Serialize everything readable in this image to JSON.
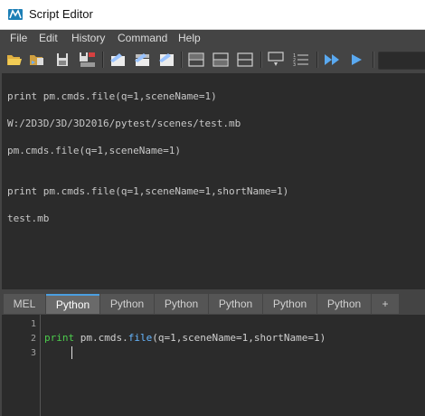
{
  "window": {
    "title": "Script Editor"
  },
  "menu": [
    "File",
    "Edit",
    "History",
    "Command",
    "Help"
  ],
  "toolbar": {
    "icons": [
      "open-script-icon",
      "source-script-icon",
      "save-script-icon",
      "save-to-shelf-icon",
      "clear-history-icon",
      "clear-input-icon",
      "clear-all-icon",
      "show-history-only-icon",
      "show-input-only-icon",
      "show-both-icon",
      "echo-all-commands-icon",
      "line-numbers-icon",
      "execute-all-icon",
      "execute-icon"
    ]
  },
  "output": {
    "lines": [
      "print pm.cmds.file(q=1,sceneName=1)",
      "W:/2D3D/3D/3D2016/pytest/scenes/test.mb",
      "pm.cmds.file(q=1,sceneName=1)",
      "print pm.cmds.file(q=1,sceneName=1,shortName=1)",
      "test.mb"
    ]
  },
  "tabs": [
    "MEL",
    "Python",
    "Python",
    "Python",
    "Python",
    "Python",
    "Python",
    "+"
  ],
  "active_tab": 1,
  "editor": {
    "line_numbers": [
      "1",
      "2",
      "3"
    ],
    "code": {
      "keyword": "print",
      "pre": "pm.cmds.",
      "func": "file",
      "args": "(q=1,sceneName=1,shortName=1)"
    }
  },
  "colors": {
    "accent": "#4b9fe0",
    "keyword": "#4ccd4c",
    "function": "#66b6ff",
    "background": "#2b2b2b"
  }
}
